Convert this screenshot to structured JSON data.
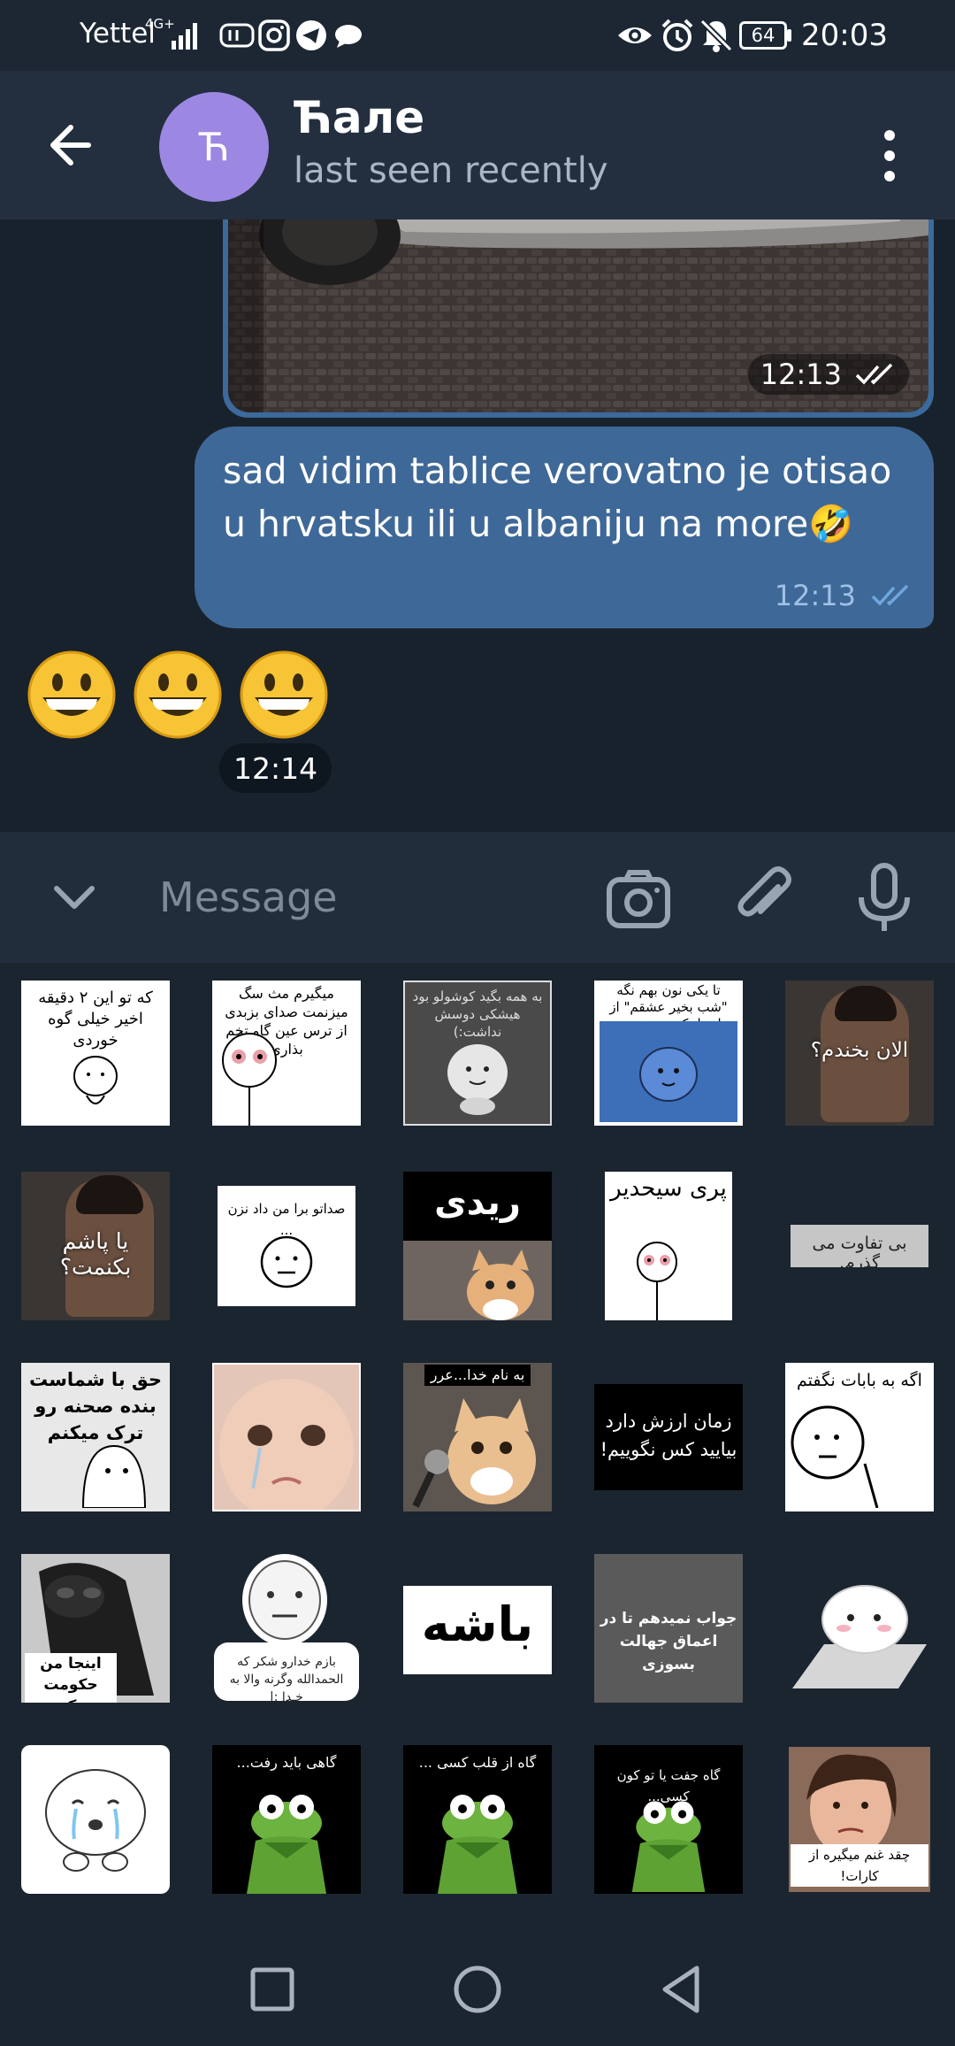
{
  "status_bar": {
    "carrier": "Yettel",
    "network": "4G+",
    "battery": "64",
    "time": "20:03"
  },
  "header": {
    "avatar_letter": "Ћ",
    "title": "Ћале",
    "status": "last seen recently"
  },
  "messages": {
    "photo_time": "12:13",
    "text": "sad vidim tablice verovatno je otisao u hrvatsku ili u albaniju na more🤣",
    "text_time": "12:13",
    "emojis": [
      "😀",
      "😀",
      "😀"
    ],
    "emoji_time": "12:14"
  },
  "input": {
    "placeholder": "Message"
  },
  "stickers": {
    "s1": "که تو این ۲ دقیقه اخیر خیلی گوه خوردی",
    "s2": "میگیرم مث سگ میزنمت صدای بزبدی از ترس عین گاو تخم بذاری",
    "s3": "به همه بگید کوشولو بود هیشکی دوسش نداشت:)",
    "s4": "تا یکی نون بهم نگه \"شب بخیر عشقم\" از اینجا تکون نمیخورم",
    "s5": "الان بخندم؟",
    "s6": "یا پاشم بکنمت؟",
    "s7": "صداتو برا من داد نزن ...",
    "s8": "ریدی",
    "s9": "پری سیحدیر",
    "s10": "بی تفاوت می گذرم.",
    "s11": "حق با شماست بنده صحنه رو ترک میکنم",
    "s12": "به نام خدا...عرر",
    "s13": "زمان ارزش دارد بیایید کس نگوییم!",
    "s14": "اگه به بابات نگفتم",
    "s15": "اینجا من حکومت میکنم",
    "s16": "بازم خدارو شکر که الحمدالله وگرنه والا به خـدا :|",
    "s17": "باشه",
    "s18": "جواب نمیدهم تا در اعماق جهالت بسوزی",
    "s19": "گاهی باید رفت...",
    "s20": "گاه از قلب کسی ...",
    "s21": "گاه جفت یا تو کون کسی...",
    "s22": "چقد غنم میگیره از کارات!"
  },
  "colors": {
    "background": "#18222d",
    "header": "#232f3e",
    "outgoing_bubble": "#3e6897",
    "accent": "#6fa6de",
    "avatar": "#9c88e3"
  }
}
